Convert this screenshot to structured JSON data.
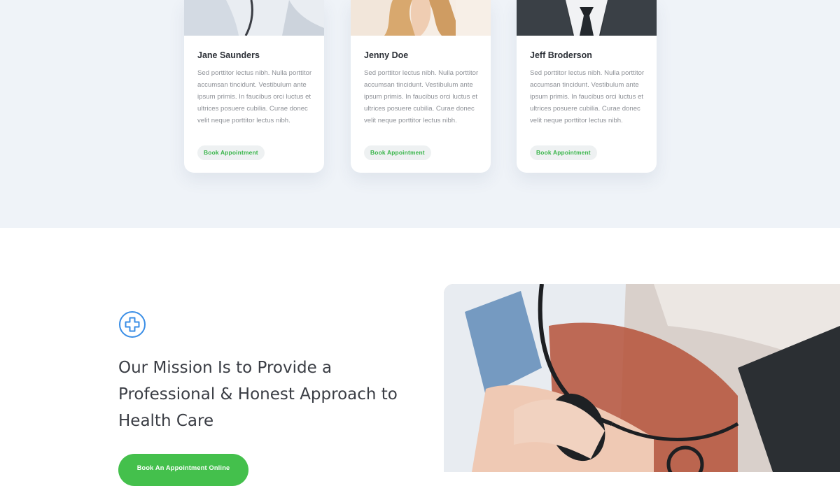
{
  "doctors": [
    {
      "name": "Jane Saunders",
      "bio": "Sed porttitor lectus nibh. Nulla porttitor accumsan tincidunt. Vestibulum ante ipsum primis. In faucibus orci luctus et ultrices posuere cubilia. Curae donec velit neque porttitor lectus nibh.",
      "cta": "Book Appointment"
    },
    {
      "name": "Jenny Doe",
      "bio": "Sed porttitor lectus nibh. Nulla porttitor accumsan tincidunt. Vestibulum ante ipsum primis. In faucibus orci luctus et ultrices posuere cubilia. Curae donec velit neque porttitor lectus nibh.",
      "cta": "Book Appointment"
    },
    {
      "name": "Jeff Broderson",
      "bio": "Sed porttitor lectus nibh. Nulla porttitor accumsan tincidunt. Vestibulum ante ipsum primis. In faucibus orci luctus et ultrices posuere cubilia. Curae donec velit neque porttitor lectus nibh.",
      "cta": "Book Appointment"
    }
  ],
  "mission": {
    "icon": "medical-cross-icon",
    "title": "Our Mission Is to Provide a Professional & Honest Approach to Health Care",
    "cta": "Book An Appointment Online"
  },
  "colors": {
    "accent_green": "#44c04c",
    "icon_blue": "#3a8ee6",
    "section_bg": "#eff3f8"
  }
}
